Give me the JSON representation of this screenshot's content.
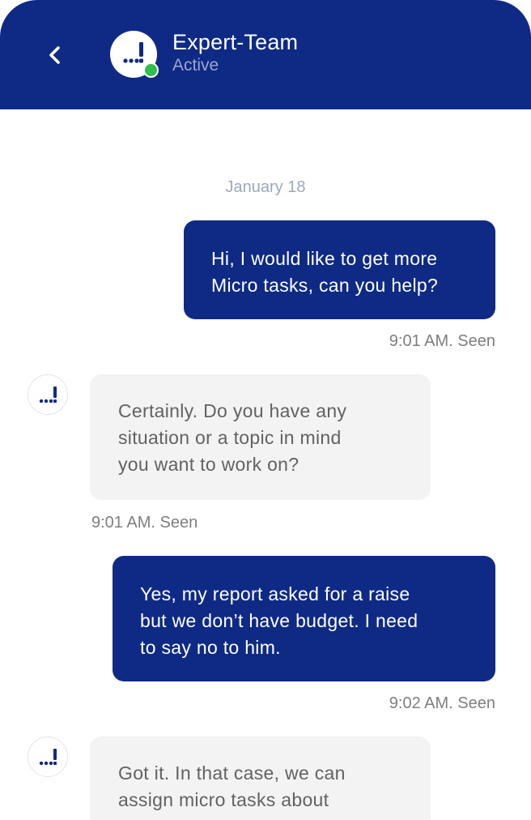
{
  "header": {
    "back_icon": "chevron-left-icon",
    "avatar_icon": "expert-team-logo",
    "title": "Expert-Team",
    "status": "Active",
    "status_color": "#2fbf4c",
    "background_color": "#0f2a85"
  },
  "chat": {
    "date_separator": "January 18",
    "messages": [
      {
        "direction": "outgoing",
        "lines": [
          "Hi, I would like to get more",
          "Micro tasks, can you help?"
        ],
        "meta": "9:01 AM. Seen"
      },
      {
        "direction": "incoming",
        "lines": [
          "Certainly. Do you have any",
          "situation or a topic in mind",
          "you want to work on?"
        ],
        "meta": "9:01 AM. Seen"
      },
      {
        "direction": "outgoing",
        "lines": [
          "Yes, my report asked for a raise",
          "but we don’t have budget. I need",
          "to say no to him."
        ],
        "meta": "9:02 AM. Seen"
      },
      {
        "direction": "incoming",
        "lines": [
          "Got it. In that case, we can",
          "assign micro tasks about"
        ],
        "meta": ""
      }
    ]
  },
  "colors": {
    "outgoing_bubble": "#0f2a85",
    "incoming_bubble": "#f3f3f3",
    "date_text": "#9ba8bd",
    "meta_text": "#7e7e7e"
  }
}
